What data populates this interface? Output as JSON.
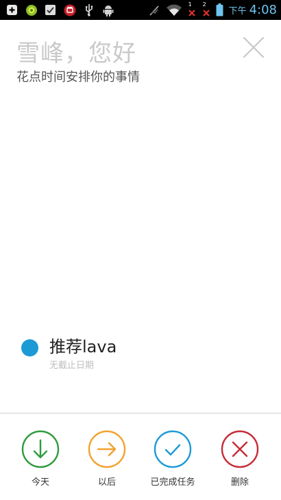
{
  "status_bar": {
    "ampm": "下午",
    "time": "4:08",
    "notif_1": "1",
    "notif_2": "2",
    "icons": [
      "plus-box-icon",
      "android-green-icon",
      "checkbox-icon",
      "red-app-icon",
      "usb-icon",
      "android-debug-icon",
      "no-signal-icon",
      "wifi-icon",
      "notification-1-icon",
      "notification-2-icon",
      "battery-icon"
    ]
  },
  "header": {
    "greeting": "雪峰，您好",
    "subtitle": "花点时间安排你的事情",
    "close_icon": "close-icon"
  },
  "task": {
    "title": "推荐lava",
    "due": "无截止日期",
    "dot_color": "#1b9ad6"
  },
  "actions": [
    {
      "label": "今天",
      "icon": "arrow-down-circle-icon",
      "color": "#2f9a3e"
    },
    {
      "label": "以后",
      "icon": "arrow-right-circle-icon",
      "color": "#f0a22e"
    },
    {
      "label": "已完成任务",
      "icon": "check-circle-icon",
      "color": "#1b9ad6"
    },
    {
      "label": "删除",
      "icon": "x-circle-icon",
      "color": "#c62a35"
    }
  ]
}
